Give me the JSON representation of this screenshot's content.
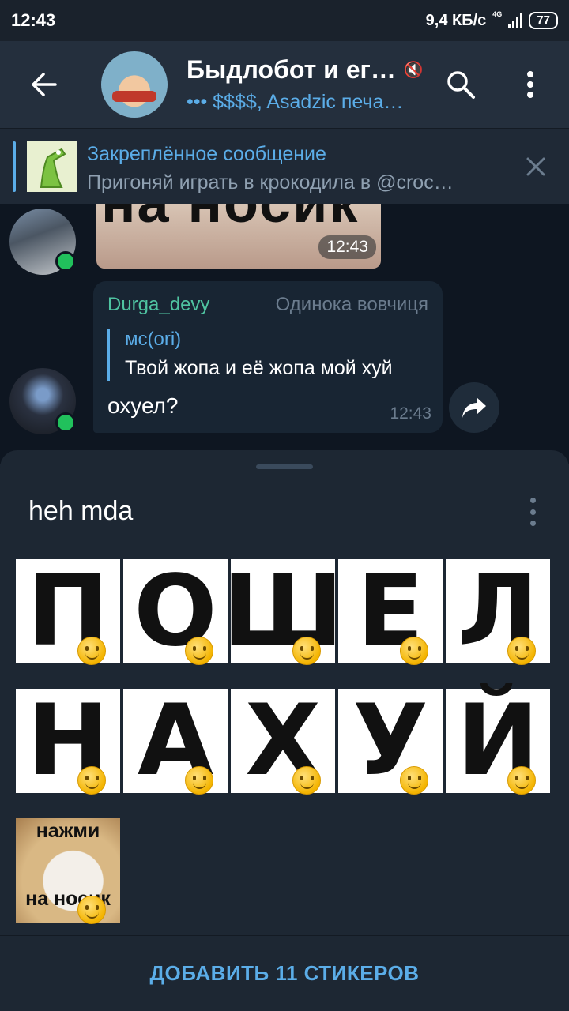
{
  "status_bar": {
    "time": "12:43",
    "net_speed": "9,4 КБ/с",
    "network": "4G",
    "battery": "77"
  },
  "header": {
    "title": "Быдлобот и ег…",
    "subtitle": "••• $$$$, Asadzic печа…"
  },
  "pinned": {
    "title": "Закреплённое сообщение",
    "text": "Пригоняй играть в крокодила в @croc…"
  },
  "messages": [
    {
      "type": "sticker_image",
      "caption": "на носик",
      "time": "12:43"
    },
    {
      "sender": "Durga_devy",
      "rank": "Одинока вовчиця",
      "reply_to_name": "мс(ori)",
      "reply_to_text": "Твой жопа и её жопа мой хуй",
      "text": "охуел?",
      "time": "12:43"
    }
  ],
  "sticker_set": {
    "title": "heh mda",
    "row1": [
      "П",
      "О",
      "Ш",
      "Е",
      "Л"
    ],
    "row2": [
      "Н",
      "А",
      "Х",
      "У",
      "Й"
    ],
    "cat_top": "нажми",
    "cat_bottom": "на носик",
    "add_label": "ДОБАВИТЬ 11 СТИКЕРОВ"
  },
  "colors": {
    "accent": "#5bade8",
    "header_bg": "#242f3d",
    "chat_bg": "#0e1621",
    "sender": "#4fc3a1",
    "online": "#21c15c"
  }
}
